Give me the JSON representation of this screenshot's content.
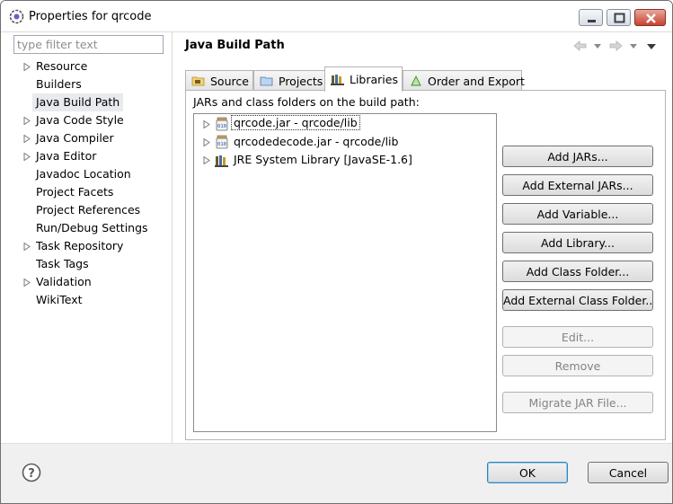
{
  "window": {
    "title": "Properties for qrcode",
    "app_icon": "eclipse-gear-icon"
  },
  "filter": {
    "placeholder": "type filter text",
    "value": ""
  },
  "nav": {
    "items": [
      {
        "label": "Resource",
        "expandable": true
      },
      {
        "label": "Builders",
        "expandable": false
      },
      {
        "label": "Java Build Path",
        "expandable": false,
        "selected": true
      },
      {
        "label": "Java Code Style",
        "expandable": true
      },
      {
        "label": "Java Compiler",
        "expandable": true
      },
      {
        "label": "Java Editor",
        "expandable": true
      },
      {
        "label": "Javadoc Location",
        "expandable": false
      },
      {
        "label": "Project Facets",
        "expandable": false
      },
      {
        "label": "Project References",
        "expandable": false
      },
      {
        "label": "Run/Debug Settings",
        "expandable": false
      },
      {
        "label": "Task Repository",
        "expandable": true
      },
      {
        "label": "Task Tags",
        "expandable": false
      },
      {
        "label": "Validation",
        "expandable": true
      },
      {
        "label": "WikiText",
        "expandable": false
      }
    ]
  },
  "page": {
    "title": "Java Build Path"
  },
  "tabs": [
    {
      "label": "Source",
      "icon": "source-folder-icon"
    },
    {
      "label": "Projects",
      "icon": "project-folder-icon"
    },
    {
      "label": "Libraries",
      "icon": "library-icon",
      "active": true
    },
    {
      "label": "Order and Export",
      "icon": "order-export-icon"
    }
  ],
  "libraries": {
    "caption": "JARs and class folders on the build path:",
    "entries": [
      {
        "label": "qrcode.jar - qrcode/lib",
        "icon": "jar-icon"
      },
      {
        "label": "qrcodedecode.jar - qrcode/lib",
        "icon": "jar-icon"
      },
      {
        "label": "JRE System Library [JavaSE-1.6]",
        "icon": "jre-library-icon"
      }
    ]
  },
  "buttons": {
    "add_jars": "Add JARs...",
    "add_external_jars": "Add External JARs...",
    "add_variable": "Add Variable...",
    "add_library": "Add Library...",
    "add_class_folder": "Add Class Folder...",
    "add_external_class_folder": "Add External Class Folder...",
    "edit": "Edit...",
    "remove": "Remove",
    "migrate_jar": "Migrate JAR File..."
  },
  "footer": {
    "ok": "OK",
    "cancel": "Cancel"
  },
  "colors": {
    "accent": "#3c7fb1",
    "selection": "#e8eaee"
  }
}
